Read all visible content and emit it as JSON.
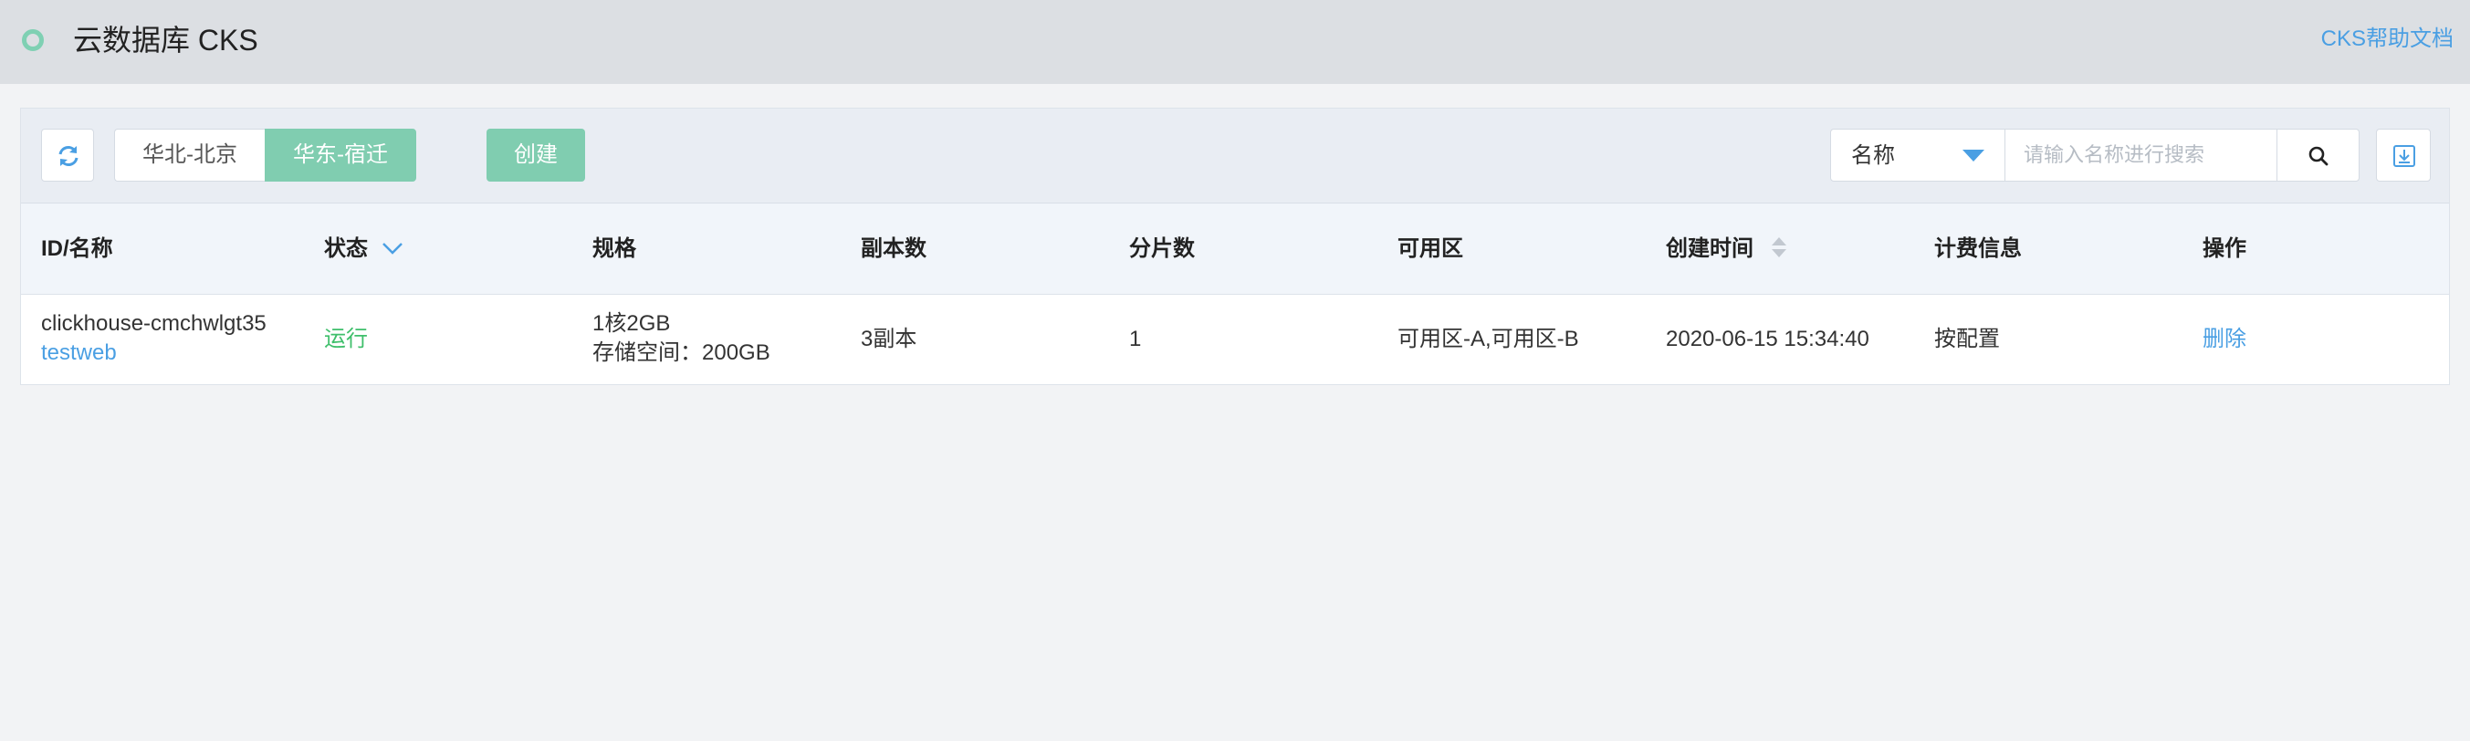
{
  "header": {
    "title": "云数据库 CKS",
    "help_link": "CKS帮助文档"
  },
  "toolbar": {
    "regions": [
      "华北-北京",
      "华东-宿迁"
    ],
    "active_region": "华东-宿迁",
    "create_label": "创建",
    "search": {
      "field": "名称",
      "placeholder": "请输入名称进行搜索",
      "value": ""
    }
  },
  "table": {
    "columns": [
      "ID/名称",
      "状态",
      "规格",
      "副本数",
      "分片数",
      "可用区",
      "创建时间",
      "计费信息",
      "操作"
    ],
    "rows": [
      {
        "id": "clickhouse-cmchwlgt35",
        "name": "testweb",
        "status": "运行",
        "spec_line1": "1核2GB",
        "spec_line2": "存储空间：200GB",
        "replicas": "3副本",
        "shards": "1",
        "zones": "可用区-A,可用区-B",
        "created_at": "2020-06-15 15:34:40",
        "billing": "按配置",
        "action": "删除"
      }
    ]
  },
  "colors": {
    "accent_green": "#80cdb0",
    "link_blue": "#4a9fe3",
    "status_running": "#3fbf6b",
    "header_bg": "#dcdfe3"
  },
  "icons": {
    "logo": "ring-logo-icon",
    "refresh": "refresh-icon",
    "dropdown": "caret-down-icon",
    "search": "search-icon",
    "export": "download-icon",
    "status_filter": "chevron-down-icon",
    "sort": "sort-icon"
  }
}
